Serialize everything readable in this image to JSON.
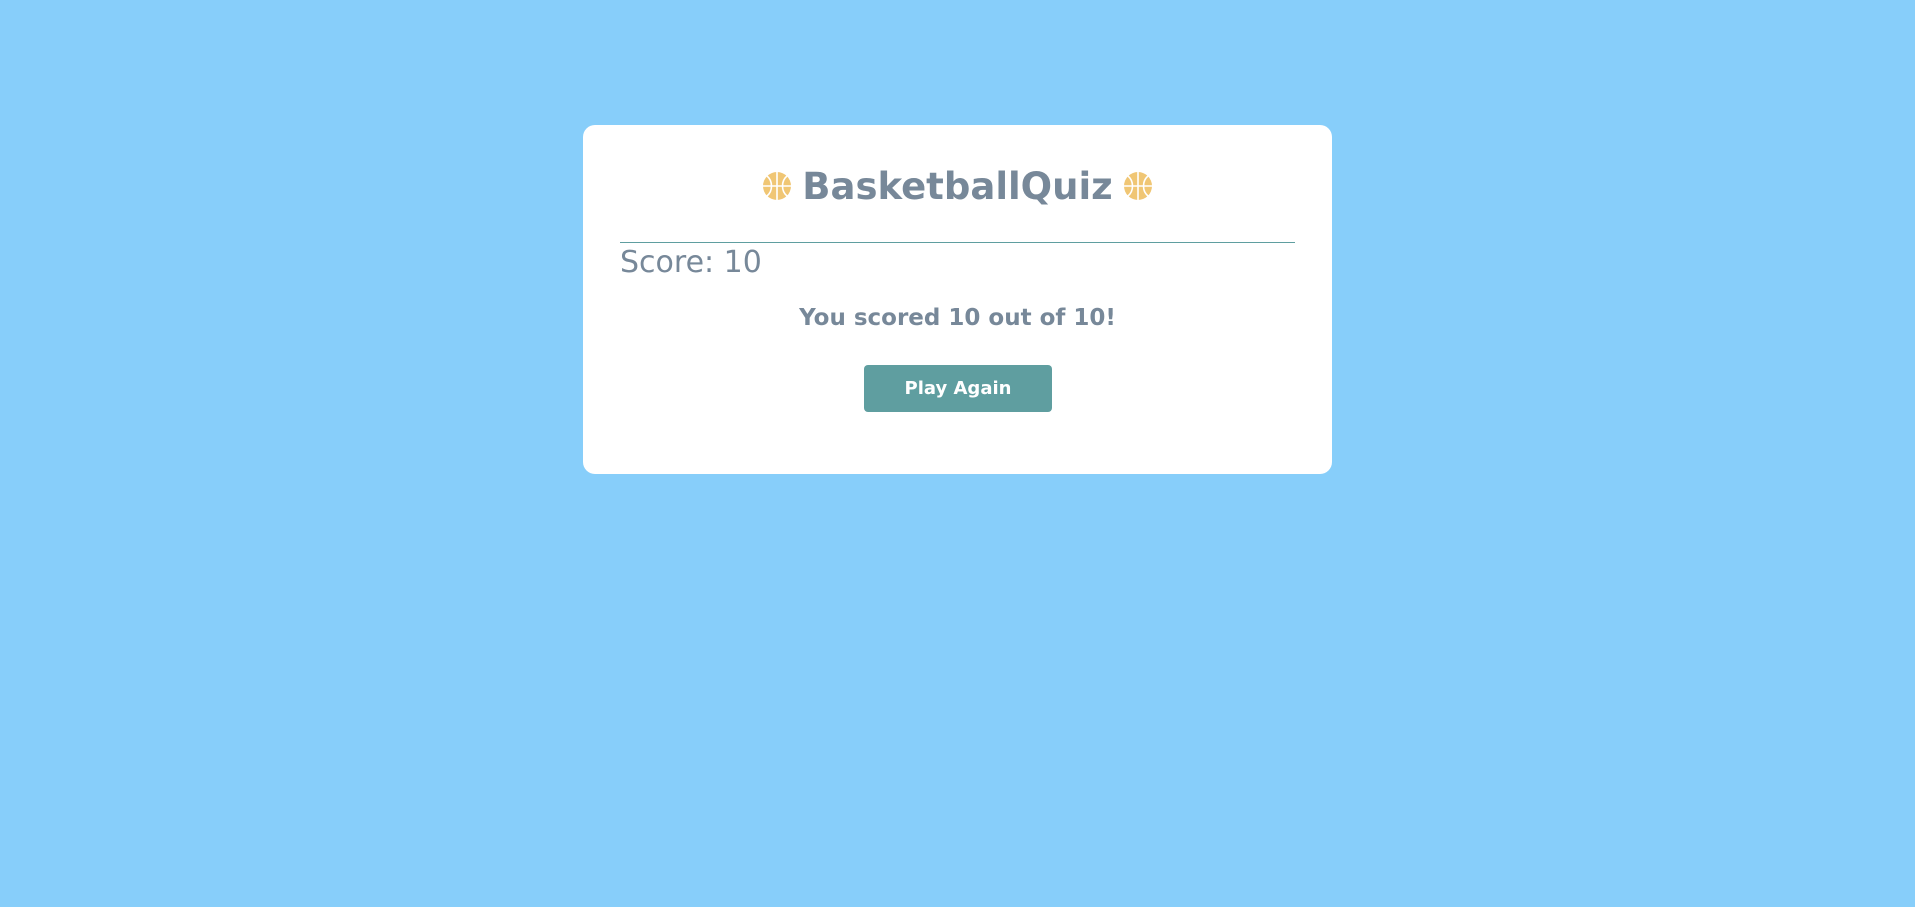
{
  "app": {
    "title": "BasketballQuiz",
    "icon": "basketball-icon"
  },
  "score": {
    "label": "Score: 10"
  },
  "result": {
    "message": "You scored 10 out of 10!"
  },
  "actions": {
    "play_again_label": "Play Again"
  },
  "colors": {
    "background": "#87cefa",
    "card": "#ffffff",
    "text": "#778899",
    "accent": "#5f9ea0",
    "ball": "#f0c674"
  }
}
